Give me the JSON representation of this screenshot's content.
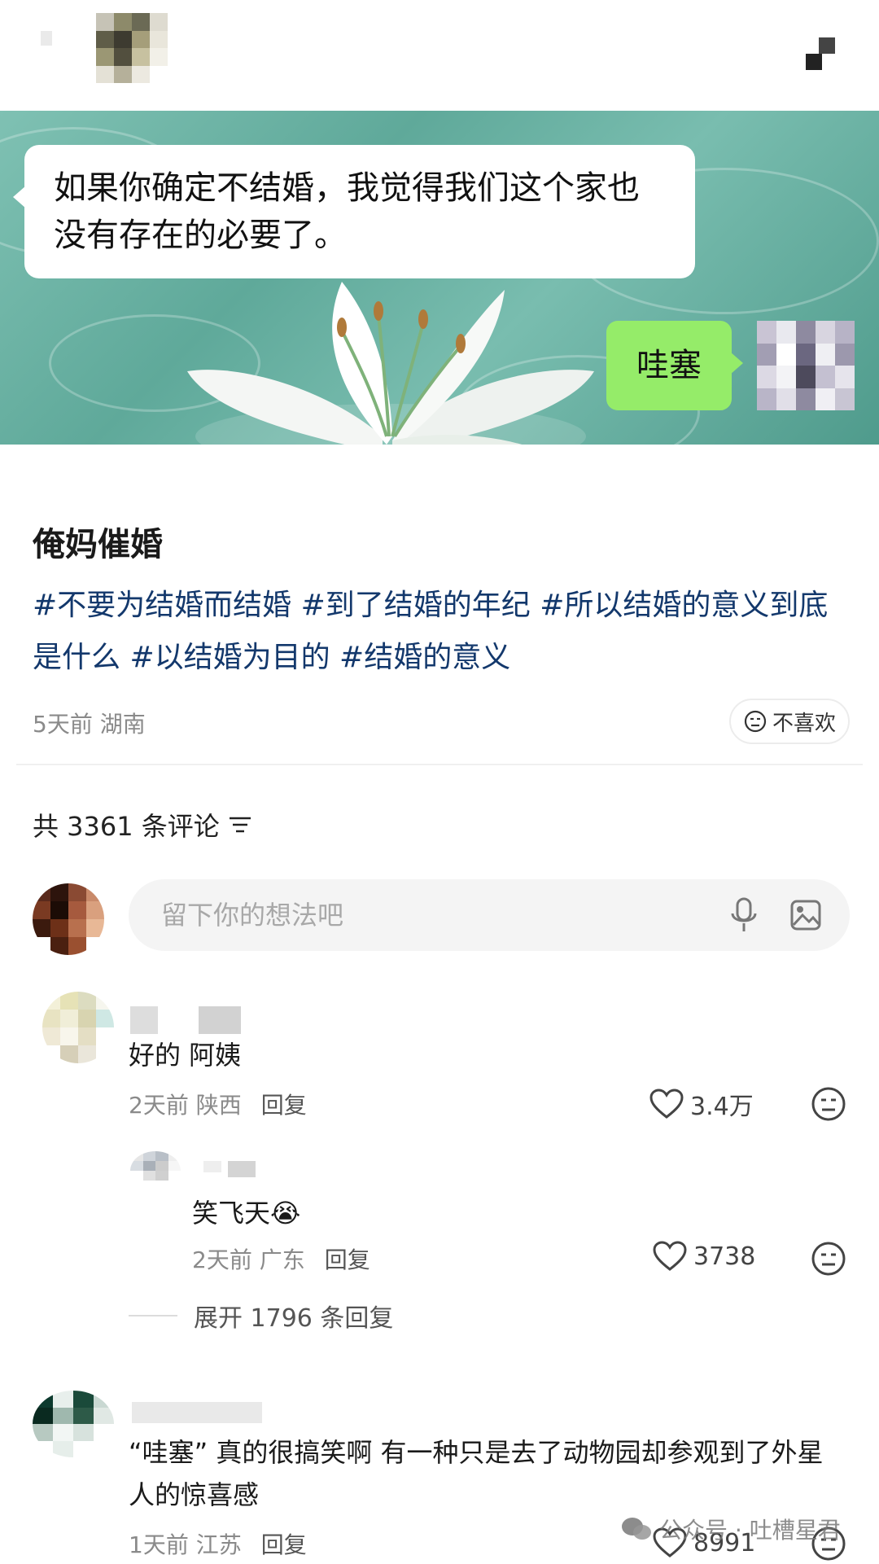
{
  "header": {
    "user_name": "",
    "follow_label": "",
    "accent": "#fe2c55"
  },
  "media": {
    "chat_message_left": "如果你确定不结婚，我觉得我们这个家也没有存在的必要了。",
    "chat_message_right": "哇塞",
    "bubble_right_color": "#95ec69",
    "water_color": "#6fb5a6"
  },
  "post": {
    "title": "俺妈催婚",
    "tags": "#不要为结婚而结婚 #到了结婚的年纪 #所以结婚的意义到底是什么 #以结婚为目的 #结婚的意义",
    "time": "5天前",
    "location": "湖南",
    "dislike_label": "不喜欢",
    "tag_color": "#13386c"
  },
  "comments_section": {
    "count_label": "共 3361 条评论",
    "input_placeholder": "留下你的想法吧",
    "comments": [
      {
        "text": "好的 阿姨",
        "time": "2天前",
        "location": "陕西",
        "reply_label": "回复",
        "likes": "3.4万"
      },
      {
        "text": "笑飞天",
        "emoji": "😭",
        "time": "2天前",
        "location": "广东",
        "reply_label": "回复",
        "likes": "3738"
      },
      {
        "text": "“哇塞” 真的很搞笑啊 有一种只是去了动物园却参观到了外星人的惊喜感",
        "time": "1天前",
        "location": "江苏",
        "reply_label": "回复",
        "likes": "8991"
      }
    ],
    "expand_label": "展开 1796 条回复"
  },
  "watermark": "公众号 · 吐槽星君",
  "icons": [
    "share-icon",
    "mic-icon",
    "image-icon",
    "heart-icon",
    "meh-icon",
    "filter-icon",
    "wechat-icon"
  ]
}
